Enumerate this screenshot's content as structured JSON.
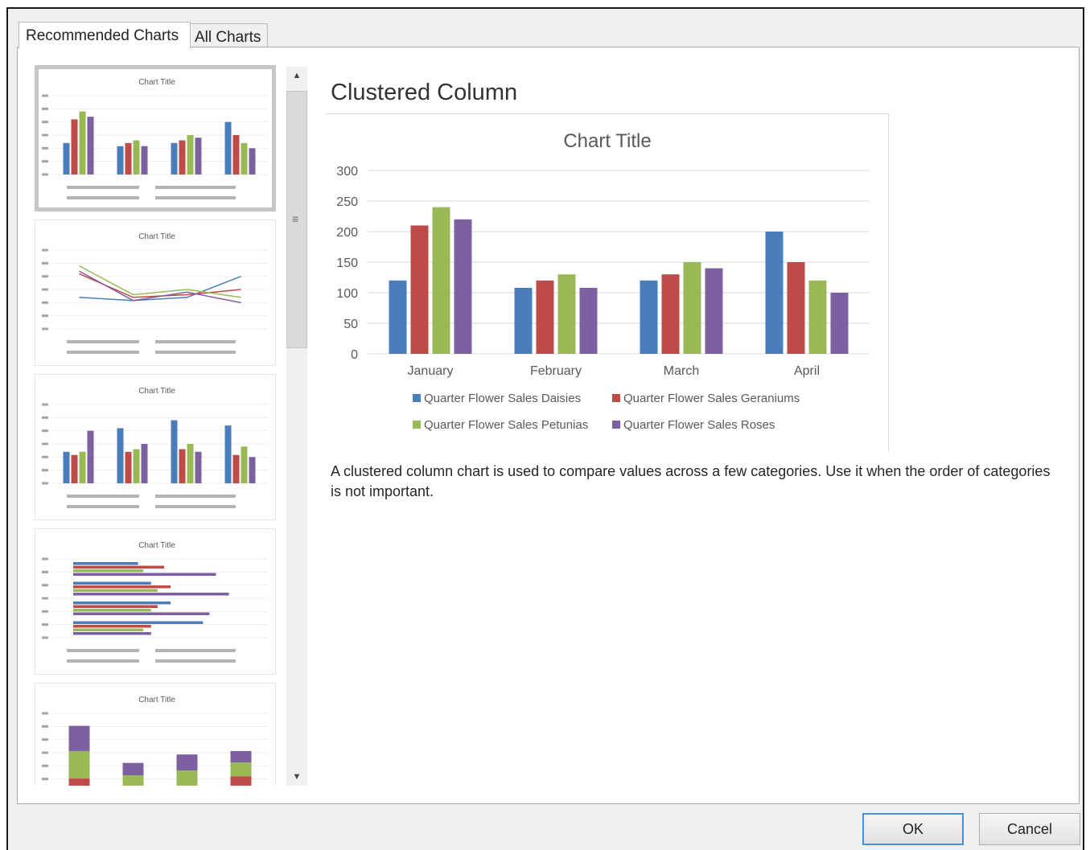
{
  "tabs": [
    {
      "label": "Recommended Charts"
    },
    {
      "label": "All Charts"
    }
  ],
  "preview": {
    "title": "Clustered Column",
    "description": "A clustered column chart is used to compare values across a few categories. Use it when the order of categories is not important."
  },
  "buttons": {
    "ok": "OK",
    "cancel": "Cancel"
  },
  "colors": {
    "daisies": "#4a7ebb",
    "geraniums": "#be4b48",
    "petunias": "#98b954",
    "roses": "#7d60a0"
  },
  "icons": {
    "scroll_up": "triangle-up-icon",
    "scroll_down": "triangle-down-icon",
    "grip": "grip-lines-icon"
  },
  "thumbnails": [
    {
      "kind": "clustered-column",
      "title": "Chart Title",
      "selected": true
    },
    {
      "kind": "line",
      "title": "Chart Title"
    },
    {
      "kind": "clustered-column-by-series",
      "title": "Chart Title"
    },
    {
      "kind": "clustered-bar",
      "title": "Chart Title"
    },
    {
      "kind": "stacked-column",
      "title": "Chart Title"
    }
  ],
  "chart_data": {
    "type": "bar",
    "title": "Chart Title",
    "categories": [
      "January",
      "February",
      "March",
      "April"
    ],
    "series": [
      {
        "name": "Quarter Flower Sales Daisies",
        "values": [
          120,
          108,
          120,
          200
        ]
      },
      {
        "name": "Quarter Flower Sales Geraniums",
        "values": [
          210,
          120,
          130,
          150
        ]
      },
      {
        "name": "Quarter Flower Sales Petunias",
        "values": [
          240,
          130,
          150,
          120
        ]
      },
      {
        "name": "Quarter Flower Sales Roses",
        "values": [
          220,
          108,
          140,
          100
        ]
      }
    ],
    "ylim": [
      0,
      300
    ],
    "yticks": [
      0,
      50,
      100,
      150,
      200,
      250,
      300
    ],
    "grid": true,
    "legend": "bottom"
  }
}
